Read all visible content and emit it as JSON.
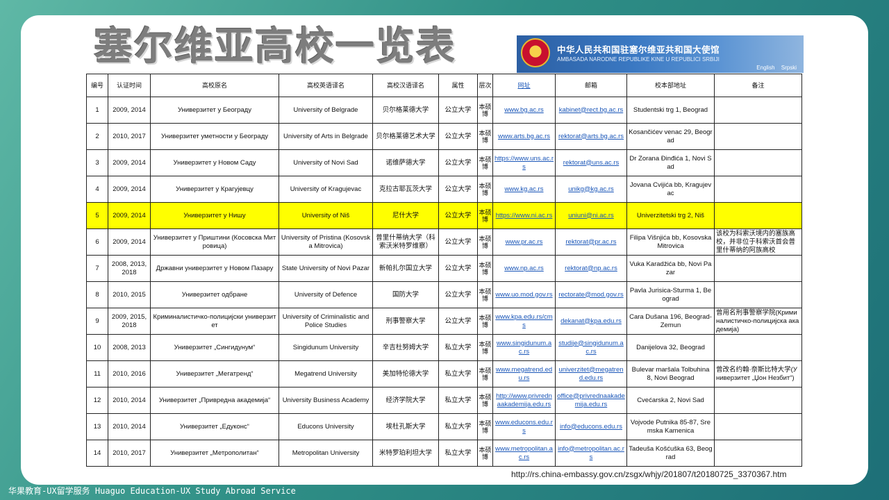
{
  "title": "塞尔维亚高校一览表",
  "banner": {
    "cn_text": "中华人民共和国驻塞尔维亚共和国大使馆",
    "en_text": "AMBASADA NARODNE REPUBLIKE KINE U REPUBLICI SRBIJI",
    "links": [
      "English",
      "Srpski"
    ]
  },
  "table": {
    "headers": [
      "编号",
      "认证时间",
      "高校原名",
      "高校英语译名",
      "高校汉语译名",
      "属性",
      "层次",
      "网址",
      "邮箱",
      "校本部地址",
      "备注"
    ],
    "rows": [
      {
        "no": "1",
        "year": "2009, 2014",
        "orig": "Универзитет у Београду",
        "en": "University of Belgrade",
        "cn": "贝尔格莱德大学",
        "type": "公立大学",
        "level": "本硕博",
        "url": "www.bg.ac.rs",
        "email": "kabinet@rect.bg.ac.rs",
        "addr": "Studentski trg 1, Beograd",
        "note": ""
      },
      {
        "no": "2",
        "year": "2010, 2017",
        "orig": "Универзитет уметности у Београду",
        "en": "University of Arts in Belgrade",
        "cn": "贝尔格莱德艺术大学",
        "type": "公立大学",
        "level": "本硕博",
        "url": "www.arts.bg.ac.rs",
        "email": "rektorat@arts.bg.ac.rs",
        "addr": "Kosančićev venac 29, Beograd",
        "note": ""
      },
      {
        "no": "3",
        "year": "2009, 2014",
        "orig": "Универзитет у Новом Саду",
        "en": "University of Novi Sad",
        "cn": "诺维萨德大学",
        "type": "公立大学",
        "level": "本硕博",
        "url": "https://www.uns.ac.rs",
        "email": "rektorat@uns.ac.rs",
        "addr": "Dr Zorana Đinđića 1, Novi Sad",
        "note": ""
      },
      {
        "no": "4",
        "year": "2009, 2014",
        "orig": "Универзитет у Крагујевцу",
        "en": "University of Kragujevac",
        "cn": "克拉古耶瓦茨大学",
        "type": "公立大学",
        "level": "本硕博",
        "url": "www.kg.ac.rs",
        "email": "unikg@kg.ac.rs",
        "addr": "Jovana Cvijića bb, Kragujevac",
        "note": ""
      },
      {
        "no": "5",
        "year": "2009, 2014",
        "orig": "Универзитет у Нишу",
        "en": "University of Niš",
        "cn": "尼什大学",
        "type": "公立大学",
        "level": "本硕博",
        "url": "https://www.ni.ac.rs",
        "email": "uniuni@ni.ac.rs",
        "addr": "Univerzitetski trg 2, Niš",
        "note": "",
        "highlight": true
      },
      {
        "no": "6",
        "year": "2009, 2014",
        "orig": "Универзитет у Приштини (Косовска Митровица)",
        "en": "University of Pristina (Kosovska Mitrovica)",
        "cn": "普里什蒂纳大学（科索沃米特罗维察）",
        "type": "公立大学",
        "level": "本硕博",
        "url": "www.pr.ac.rs",
        "email": "rektorat@pr.ac.rs",
        "addr": "Filipa Višnjića bb, Kosovska Mitrovica",
        "note": "该校为科索沃境内的塞族高校，并非位于科索沃首会普里什蒂纳的阿族高校"
      },
      {
        "no": "7",
        "year": "2008, 2013, 2018",
        "orig": "Државни универзитет у Новом Пазару",
        "en": "State University of Novi Pazar",
        "cn": "新帕扎尔国立大学",
        "type": "公立大学",
        "level": "本硕博",
        "url": "www.np.ac.rs",
        "email": "rektorat@np.ac.rs",
        "addr": "Vuka Karadžića bb, Novi Pazar",
        "note": ""
      },
      {
        "no": "8",
        "year": "2010, 2015",
        "orig": "Универзитет одбране",
        "en": "University of Defence",
        "cn": "国防大学",
        "type": "公立大学",
        "level": "本硕博",
        "url": "www.uo.mod.gov.rs",
        "email": "rectorate@mod.gov.rs",
        "addr": "Pavla Jurisica-Sturma 1, Beograd",
        "note": ""
      },
      {
        "no": "9",
        "year": "2009, 2015, 2018",
        "orig": "Криминалистичко-полицијски универзитет",
        "en": "University of Criminalistic and Police Studies",
        "cn": "刑事警察大学",
        "type": "公立大学",
        "level": "本硕博",
        "url": "www.kpa.edu.rs/cms",
        "email": "dekanat@kpa.edu.rs",
        "addr": "Cara Dušana 196, Beograd-Zemun",
        "note": "曾用名刑事警察学院(Криминалистичко-полицијска академија)"
      },
      {
        "no": "10",
        "year": "2008, 2013",
        "orig": "Универзитет „Сингидунум“",
        "en": "Singidunum University",
        "cn": "辛吉杜努姆大学",
        "type": "私立大学",
        "level": "本硕博",
        "url": "www.singidunum.ac.rs",
        "email": "studije@singidunum.ac.rs",
        "addr": "Danijelova 32, Beograd",
        "note": ""
      },
      {
        "no": "11",
        "year": "2010, 2016",
        "orig": "Универзитет „Мегатренд“",
        "en": "Megatrend University",
        "cn": "美加特伦德大学",
        "type": "私立大学",
        "level": "本硕博",
        "url": "www.megatrend.edu.rs",
        "email": "univerzitet@megatrend.edu.rs",
        "addr": "Bulevar maršala Tolbuhina 8, Novi Beograd",
        "note": "曾改名约翰·奈斯比特大学(Универзитет „Џон Незбит“)"
      },
      {
        "no": "12",
        "year": "2010, 2014",
        "orig": "Универзитет „Привредна академија“",
        "en": "University Business Academy",
        "cn": "经济学院大学",
        "type": "私立大学",
        "level": "本硕博",
        "url": "http://www.privrednaakademija.edu.rs",
        "email": "office@privrednaakademija.edu.rs",
        "addr": "Cvećarska 2, Novi Sad",
        "note": ""
      },
      {
        "no": "13",
        "year": "2010, 2014",
        "orig": "Универзитет „Едуконс“",
        "en": "Educons University",
        "cn": "埃杜孔斯大学",
        "type": "私立大学",
        "level": "本硕博",
        "url": "www.educons.edu.rs",
        "email": "info@educons.edu.rs",
        "addr": "Vojvode Putnika 85-87, Sremska Kamenica",
        "note": ""
      },
      {
        "no": "14",
        "year": "2010, 2017",
        "orig": "Универзитет „Метрополитан“",
        "en": "Metropolitan University",
        "cn": "米特罗珀利坦大学",
        "type": "私立大学",
        "level": "本硕博",
        "url": "www.metropolitan.ac.rs",
        "email": "info@metropolitan.ac.rs",
        "addr": "Tadeuša Košćuška 63, Beograd",
        "note": ""
      }
    ]
  },
  "source_url": "http://rs.china-embassy.gov.cn/zsgx/whjy/201807/t20180725_3370367.htm",
  "footer": "华果教育-UX留学服务 Huaguo Education-UX Study Abroad Service"
}
